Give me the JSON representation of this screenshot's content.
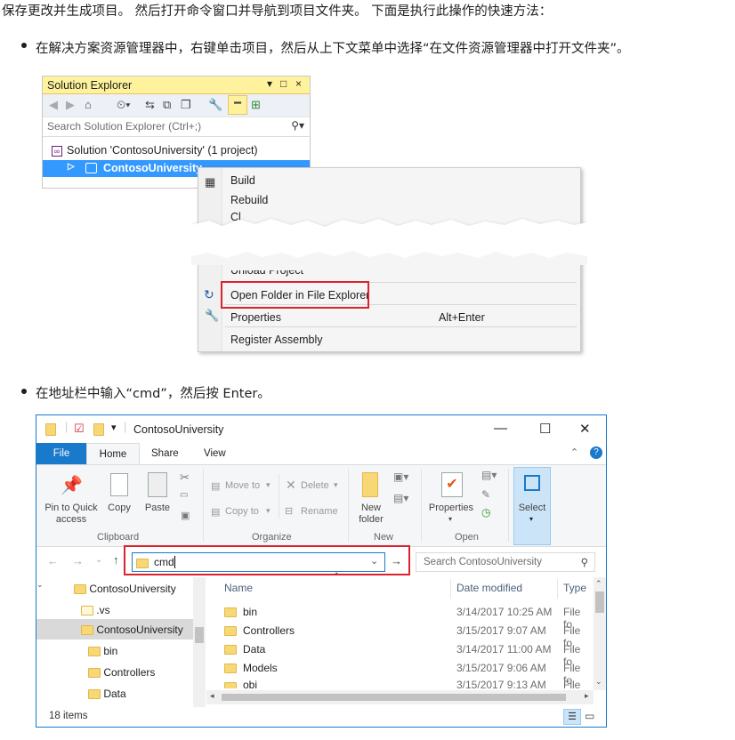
{
  "intro": "保存更改并生成项目。 然后打开命令窗口并导航到项目文件夹。 下面是执行此操作的快速方法：",
  "bullet1": "在解决方案资源管理器中，右键单击项目，然后从上下文菜单中选择“在文件资源管理器中打开文件夹”。",
  "bullet2": "在地址栏中输入“cmd”，然后按 Enter。",
  "solution_explorer": {
    "title": "Solution Explorer",
    "title_controls": [
      "▾",
      "□",
      "×"
    ],
    "search_placeholder": "Search Solution Explorer (Ctrl+;)",
    "solution_row": "Solution 'ContosoUniversity' (1 project)",
    "project_row": "ContosoUniversity"
  },
  "context_menu": {
    "items": [
      "Build",
      "Rebuild",
      "Unload Project",
      "Open Folder in File Explorer",
      "Properties",
      "Register Assembly"
    ],
    "properties_shortcut": "Alt+Enter",
    "cut_text_1": "Cl",
    "cut_text_2": "Unload Project"
  },
  "explorer": {
    "title": "ContosoUniversity",
    "tabs": [
      "File",
      "Home",
      "Share",
      "View"
    ],
    "ribbon": {
      "clipboard": {
        "group": "Clipboard",
        "pin": "Pin to Quick access",
        "copy": "Copy",
        "paste": "Paste"
      },
      "organize": {
        "group": "Organize",
        "move_to": "Move to",
        "copy_to": "Copy to",
        "delete": "Delete",
        "rename": "Rename"
      },
      "new": {
        "group": "New",
        "new_folder": "New folder"
      },
      "open": {
        "group": "Open",
        "properties": "Properties"
      },
      "select": {
        "label": "Select"
      }
    },
    "address_value": "cmd",
    "search_placeholder": "Search ContosoUniversity",
    "tree": [
      "ContosoUniversity",
      ".vs",
      "ContosoUniversity",
      "bin",
      "Controllers",
      "Data"
    ],
    "columns": [
      "Name",
      "Date modified",
      "Type"
    ],
    "rows": [
      {
        "name": "bin",
        "date": "3/14/2017 10:25 AM",
        "type": "File fo"
      },
      {
        "name": "Controllers",
        "date": "3/15/2017 9:07 AM",
        "type": "File fo"
      },
      {
        "name": "Data",
        "date": "3/14/2017 11:00 AM",
        "type": "File fo"
      },
      {
        "name": "Models",
        "date": "3/15/2017 9:06 AM",
        "type": "File fo"
      },
      {
        "name": "obj",
        "date": "3/15/2017 9:13 AM",
        "type": "File fo"
      }
    ],
    "status": "18 items"
  },
  "colors": {
    "accent": "#1979ca",
    "highlight_box": "#d9242d",
    "selection": "#3399ff",
    "se_title": "#fff29d"
  }
}
